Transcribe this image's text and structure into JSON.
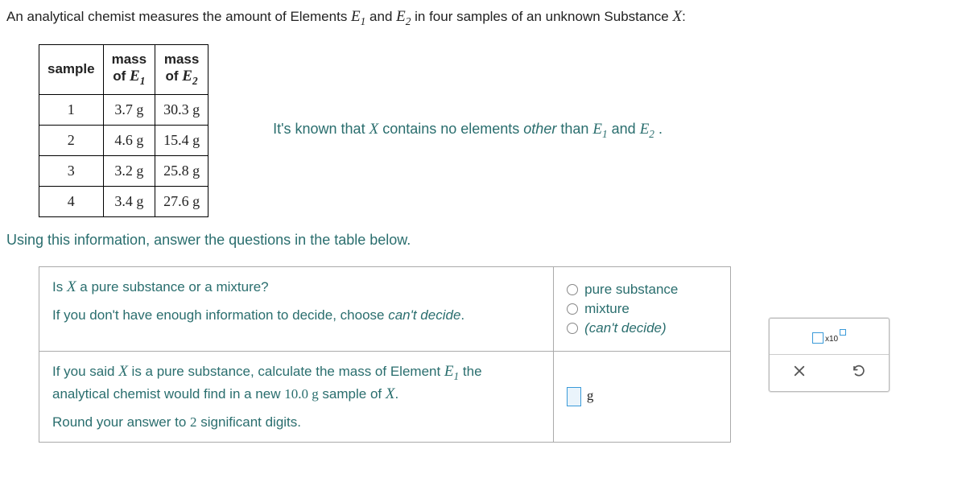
{
  "intro": {
    "prefix": "An analytical chemist measures the amount of Elements ",
    "e1": "E",
    "sub1": "1",
    "and": " and ",
    "e2": "E",
    "sub2": "2",
    "suffix": " in four samples of an unknown Substance ",
    "x": "X",
    "colon": ":"
  },
  "table_headers": {
    "sample": "sample",
    "mass_prefix": "mass",
    "of": "of ",
    "e1": "E",
    "sub1": "1",
    "e2": "E",
    "sub2": "2"
  },
  "rows": [
    {
      "n": "1",
      "m1": "3.7 g",
      "m2": "30.3 g"
    },
    {
      "n": "2",
      "m1": "4.6 g",
      "m2": "15.4 g"
    },
    {
      "n": "3",
      "m1": "3.2 g",
      "m2": "25.8 g"
    },
    {
      "n": "4",
      "m1": "3.4 g",
      "m2": "27.6 g"
    }
  ],
  "known": {
    "p1": "It's known that ",
    "x": "X",
    "p2": " contains no elements ",
    "other": "other",
    "p3": " than ",
    "e1": "E",
    "s1": "1",
    "and": " and ",
    "e2": "E",
    "s2": "2",
    "dot": " ."
  },
  "instruction": "Using this information, answer the questions in the table below.",
  "q1": {
    "line1a": "Is ",
    "x": "X",
    "line1b": " a pure substance or a mixture?",
    "line2a": "If you don't have enough information to decide, choose ",
    "cant": "can't decide",
    "dot": "."
  },
  "options": {
    "pure": "pure substance",
    "mixture": "mixture",
    "cant": "(can't decide)"
  },
  "q2": {
    "l1a": "If you said ",
    "x": "X",
    "l1b": " is a pure substance, calculate the mass of Element ",
    "e1": "E",
    "s1": "1",
    "l1c": " the",
    "l2a": "analytical chemist would find in a new ",
    "ten": "10.0 g",
    "l2b": " sample of ",
    "x2": "X",
    "dot": ".",
    "l3a": "Round your answer to ",
    "two": "2",
    "l3b": " significant digits."
  },
  "answer_unit": "g",
  "sci": "x10"
}
